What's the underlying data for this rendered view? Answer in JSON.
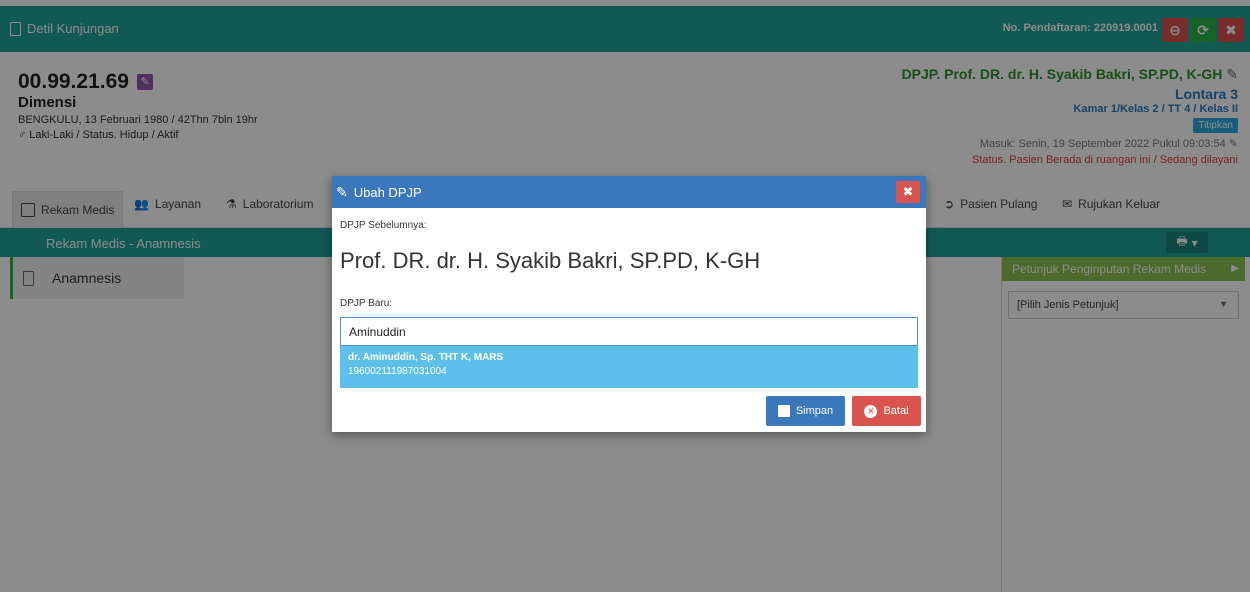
{
  "topbar": {
    "title": "Detil Kunjungan",
    "registration": "No. Pendaftaran: 220919.0001",
    "minus_icon": "minus-circle-icon",
    "refresh_icon": "refresh-icon",
    "close_icon": "close-icon"
  },
  "patient": {
    "id": "00.99.21.69",
    "name": "Dimensi",
    "birth_info": "BENGKULU, 13 Februari 1980 / 42Thn 7bln 19hr",
    "gender_status": "♂ Laki-Laki / Status. Hidup / Aktif"
  },
  "visit": {
    "doctor": "DPJP. Prof. DR. dr. H. Syakib Bakri, SP.PD, K-GH",
    "room": "Lontara 3",
    "kamar": "Kamar 1/Kelas 2 / TT 4 / Kelas II",
    "titipan": "Titipkan",
    "masuk": "Masuk: Senin, 19 September 2022 Pukul 09:03:54",
    "status": "Status. Pasien Berada di ruangan ini / Sedang dilayani"
  },
  "tabs": {
    "rekam_medis": "Rekam Medis",
    "layanan": "Layanan",
    "laboratorium": "Laboratorium",
    "pasien_pulang": "Pasien Pulang",
    "rujukan_keluar": "Rujukan Keluar"
  },
  "section": {
    "title": "Rekam Medis - Anamnesis"
  },
  "sidebar": {
    "items": [
      {
        "label": "Anamnesis"
      }
    ]
  },
  "petunjuk": {
    "title": "Petunjuk Penginputan Rekam Medis",
    "select_value": "[Pilih Jenis Petunjuk]"
  },
  "modal": {
    "title": "Ubah DPJP",
    "prev_label": "DPJP Sebelumnya:",
    "prev_value": "Prof. DR. dr. H. Syakib Bakri, SP.PD, K-GH",
    "new_label": "DPJP Baru:",
    "input_value": "Aminuddin",
    "suggestion": {
      "name": "dr. Aminuddin, Sp. THT K, MARS",
      "nip": "196002111987031004"
    },
    "save_label": "Simpan",
    "cancel_label": "Batal"
  },
  "colors": {
    "header": "#1fa398",
    "modal_header": "#3a77bb",
    "danger": "#d9534f",
    "suggestion": "#5cc0ea",
    "doctor_text": "#2e8b2e"
  }
}
